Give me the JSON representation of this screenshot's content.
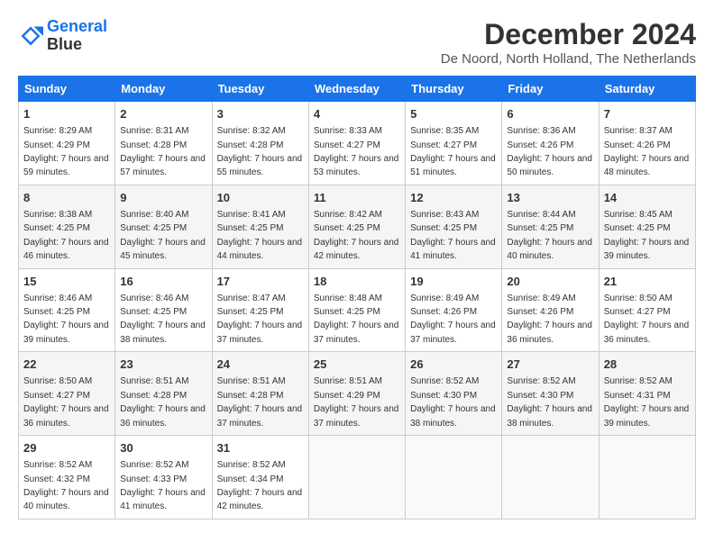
{
  "header": {
    "logo_line1": "General",
    "logo_line2": "Blue",
    "main_title": "December 2024",
    "subtitle": "De Noord, North Holland, The Netherlands"
  },
  "calendar": {
    "days_of_week": [
      "Sunday",
      "Monday",
      "Tuesday",
      "Wednesday",
      "Thursday",
      "Friday",
      "Saturday"
    ],
    "weeks": [
      [
        {
          "day": "1",
          "sunrise": "Sunrise: 8:29 AM",
          "sunset": "Sunset: 4:29 PM",
          "daylight": "Daylight: 7 hours and 59 minutes."
        },
        {
          "day": "2",
          "sunrise": "Sunrise: 8:31 AM",
          "sunset": "Sunset: 4:28 PM",
          "daylight": "Daylight: 7 hours and 57 minutes."
        },
        {
          "day": "3",
          "sunrise": "Sunrise: 8:32 AM",
          "sunset": "Sunset: 4:28 PM",
          "daylight": "Daylight: 7 hours and 55 minutes."
        },
        {
          "day": "4",
          "sunrise": "Sunrise: 8:33 AM",
          "sunset": "Sunset: 4:27 PM",
          "daylight": "Daylight: 7 hours and 53 minutes."
        },
        {
          "day": "5",
          "sunrise": "Sunrise: 8:35 AM",
          "sunset": "Sunset: 4:27 PM",
          "daylight": "Daylight: 7 hours and 51 minutes."
        },
        {
          "day": "6",
          "sunrise": "Sunrise: 8:36 AM",
          "sunset": "Sunset: 4:26 PM",
          "daylight": "Daylight: 7 hours and 50 minutes."
        },
        {
          "day": "7",
          "sunrise": "Sunrise: 8:37 AM",
          "sunset": "Sunset: 4:26 PM",
          "daylight": "Daylight: 7 hours and 48 minutes."
        }
      ],
      [
        {
          "day": "8",
          "sunrise": "Sunrise: 8:38 AM",
          "sunset": "Sunset: 4:25 PM",
          "daylight": "Daylight: 7 hours and 46 minutes."
        },
        {
          "day": "9",
          "sunrise": "Sunrise: 8:40 AM",
          "sunset": "Sunset: 4:25 PM",
          "daylight": "Daylight: 7 hours and 45 minutes."
        },
        {
          "day": "10",
          "sunrise": "Sunrise: 8:41 AM",
          "sunset": "Sunset: 4:25 PM",
          "daylight": "Daylight: 7 hours and 44 minutes."
        },
        {
          "day": "11",
          "sunrise": "Sunrise: 8:42 AM",
          "sunset": "Sunset: 4:25 PM",
          "daylight": "Daylight: 7 hours and 42 minutes."
        },
        {
          "day": "12",
          "sunrise": "Sunrise: 8:43 AM",
          "sunset": "Sunset: 4:25 PM",
          "daylight": "Daylight: 7 hours and 41 minutes."
        },
        {
          "day": "13",
          "sunrise": "Sunrise: 8:44 AM",
          "sunset": "Sunset: 4:25 PM",
          "daylight": "Daylight: 7 hours and 40 minutes."
        },
        {
          "day": "14",
          "sunrise": "Sunrise: 8:45 AM",
          "sunset": "Sunset: 4:25 PM",
          "daylight": "Daylight: 7 hours and 39 minutes."
        }
      ],
      [
        {
          "day": "15",
          "sunrise": "Sunrise: 8:46 AM",
          "sunset": "Sunset: 4:25 PM",
          "daylight": "Daylight: 7 hours and 39 minutes."
        },
        {
          "day": "16",
          "sunrise": "Sunrise: 8:46 AM",
          "sunset": "Sunset: 4:25 PM",
          "daylight": "Daylight: 7 hours and 38 minutes."
        },
        {
          "day": "17",
          "sunrise": "Sunrise: 8:47 AM",
          "sunset": "Sunset: 4:25 PM",
          "daylight": "Daylight: 7 hours and 37 minutes."
        },
        {
          "day": "18",
          "sunrise": "Sunrise: 8:48 AM",
          "sunset": "Sunset: 4:25 PM",
          "daylight": "Daylight: 7 hours and 37 minutes."
        },
        {
          "day": "19",
          "sunrise": "Sunrise: 8:49 AM",
          "sunset": "Sunset: 4:26 PM",
          "daylight": "Daylight: 7 hours and 37 minutes."
        },
        {
          "day": "20",
          "sunrise": "Sunrise: 8:49 AM",
          "sunset": "Sunset: 4:26 PM",
          "daylight": "Daylight: 7 hours and 36 minutes."
        },
        {
          "day": "21",
          "sunrise": "Sunrise: 8:50 AM",
          "sunset": "Sunset: 4:27 PM",
          "daylight": "Daylight: 7 hours and 36 minutes."
        }
      ],
      [
        {
          "day": "22",
          "sunrise": "Sunrise: 8:50 AM",
          "sunset": "Sunset: 4:27 PM",
          "daylight": "Daylight: 7 hours and 36 minutes."
        },
        {
          "day": "23",
          "sunrise": "Sunrise: 8:51 AM",
          "sunset": "Sunset: 4:28 PM",
          "daylight": "Daylight: 7 hours and 36 minutes."
        },
        {
          "day": "24",
          "sunrise": "Sunrise: 8:51 AM",
          "sunset": "Sunset: 4:28 PM",
          "daylight": "Daylight: 7 hours and 37 minutes."
        },
        {
          "day": "25",
          "sunrise": "Sunrise: 8:51 AM",
          "sunset": "Sunset: 4:29 PM",
          "daylight": "Daylight: 7 hours and 37 minutes."
        },
        {
          "day": "26",
          "sunrise": "Sunrise: 8:52 AM",
          "sunset": "Sunset: 4:30 PM",
          "daylight": "Daylight: 7 hours and 38 minutes."
        },
        {
          "day": "27",
          "sunrise": "Sunrise: 8:52 AM",
          "sunset": "Sunset: 4:30 PM",
          "daylight": "Daylight: 7 hours and 38 minutes."
        },
        {
          "day": "28",
          "sunrise": "Sunrise: 8:52 AM",
          "sunset": "Sunset: 4:31 PM",
          "daylight": "Daylight: 7 hours and 39 minutes."
        }
      ],
      [
        {
          "day": "29",
          "sunrise": "Sunrise: 8:52 AM",
          "sunset": "Sunset: 4:32 PM",
          "daylight": "Daylight: 7 hours and 40 minutes."
        },
        {
          "day": "30",
          "sunrise": "Sunrise: 8:52 AM",
          "sunset": "Sunset: 4:33 PM",
          "daylight": "Daylight: 7 hours and 41 minutes."
        },
        {
          "day": "31",
          "sunrise": "Sunrise: 8:52 AM",
          "sunset": "Sunset: 4:34 PM",
          "daylight": "Daylight: 7 hours and 42 minutes."
        },
        null,
        null,
        null,
        null
      ]
    ]
  }
}
